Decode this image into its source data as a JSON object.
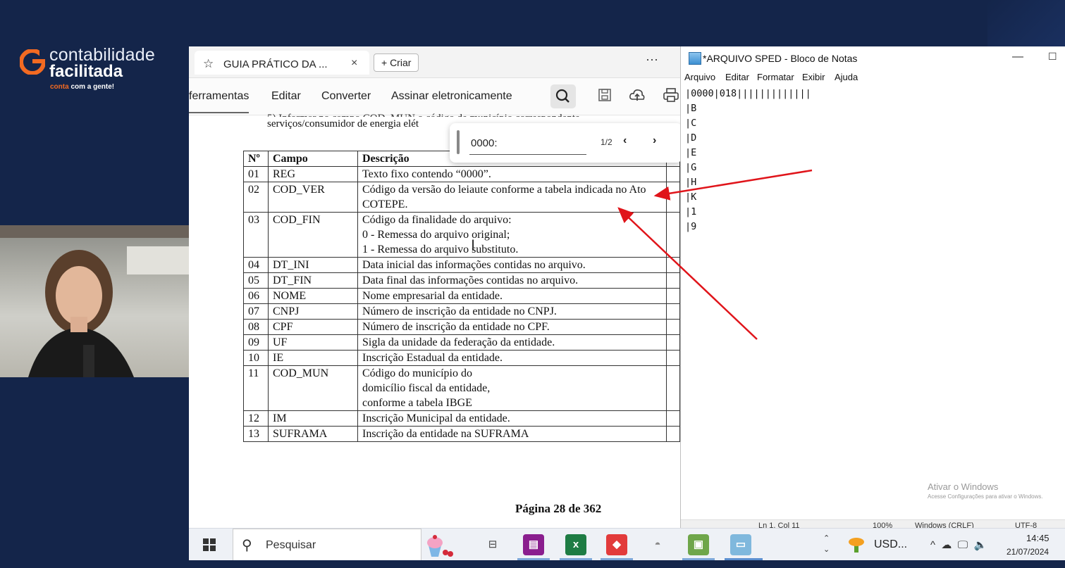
{
  "brand": {
    "line1": "contabilidade",
    "line2": "facilitada",
    "tag_accent": "conta",
    "tag_rest": " com a gente!",
    "accent_color": "#f26a22"
  },
  "browser": {
    "tab_title": "GUIA PRÁTICO DA ...",
    "tab_close": "×",
    "new_tab_label": "+ Criar",
    "more": "···"
  },
  "pdf_toolbar": {
    "items": [
      "ferramentas",
      "Editar",
      "Converter",
      "Assinar eletronicamente"
    ],
    "icons": [
      "search-icon",
      "save-icon",
      "upload-icon",
      "print-icon"
    ]
  },
  "pdf": {
    "intro_cut": "5) Informar no campo COD_MUN o código de município correspondente",
    "intro_line2": "serviços/consumidor de energia elét",
    "headers": [
      "Nº",
      "Campo",
      "Descrição"
    ],
    "rows": [
      {
        "n": "01",
        "campo": "REG",
        "desc": "Texto fixo contendo “0000”."
      },
      {
        "n": "02",
        "campo": "COD_VER",
        "desc": "Código da versão do leiaute conforme a tabela indicada no Ato COTEPE."
      },
      {
        "n": "03",
        "campo": "COD_FIN",
        "desc": "Código da finalidade do arquivo:\n0 - Remessa do arquivo original;\n1 - Remessa do arquivo substituto."
      },
      {
        "n": "04",
        "campo": "DT_INI",
        "desc": "Data inicial das informações contidas no arquivo."
      },
      {
        "n": "05",
        "campo": "DT_FIN",
        "desc": "Data final das informações contidas no arquivo."
      },
      {
        "n": "06",
        "campo": "NOME",
        "desc": "Nome empresarial da entidade."
      },
      {
        "n": "07",
        "campo": "CNPJ",
        "desc": "Número de inscrição da entidade no CNPJ."
      },
      {
        "n": "08",
        "campo": "CPF",
        "desc": "Número de inscrição da entidade no CPF."
      },
      {
        "n": "09",
        "campo": "UF",
        "desc": "Sigla da unidade da federação da entidade."
      },
      {
        "n": "10",
        "campo": "IE",
        "desc": "Inscrição Estadual da entidade."
      },
      {
        "n": "11",
        "campo": "COD_MUN",
        "desc": "Código do município do\ndomicílio fiscal da entidade,\nconforme a tabela IBGE"
      },
      {
        "n": "12",
        "campo": "IM",
        "desc": "Inscrição Municipal da entidade."
      },
      {
        "n": "13",
        "campo": "SUFRAMA",
        "desc": "Inscrição da entidade na SUFRAMA"
      }
    ],
    "page_label": "Página 28 de 362"
  },
  "find": {
    "query": "0000:",
    "count": "1/2",
    "prev": "‹",
    "next": "›"
  },
  "notepad": {
    "title": "*ARQUIVO SPED - Bloco de Notas",
    "menu": [
      "Arquivo",
      "Editar",
      "Formatar",
      "Exibir",
      "Ajuda"
    ],
    "lines": [
      "|0000|018|||||||||||||",
      "|B",
      "|C",
      "|D",
      "|E",
      "|G",
      "|H",
      "|K",
      "|1",
      "|9"
    ],
    "status": [
      "Ln 1, Col 11",
      "100%",
      "Windows (CRLF)",
      "UTF-8"
    ],
    "activate_title": "Ativar o Windows",
    "activate_sub": "Acesse Configurações para ativar o Windows."
  },
  "taskbar": {
    "search_placeholder": "Pesquisar",
    "usd_label": "USD...",
    "time": "14:45",
    "date": "21/07/2024"
  }
}
